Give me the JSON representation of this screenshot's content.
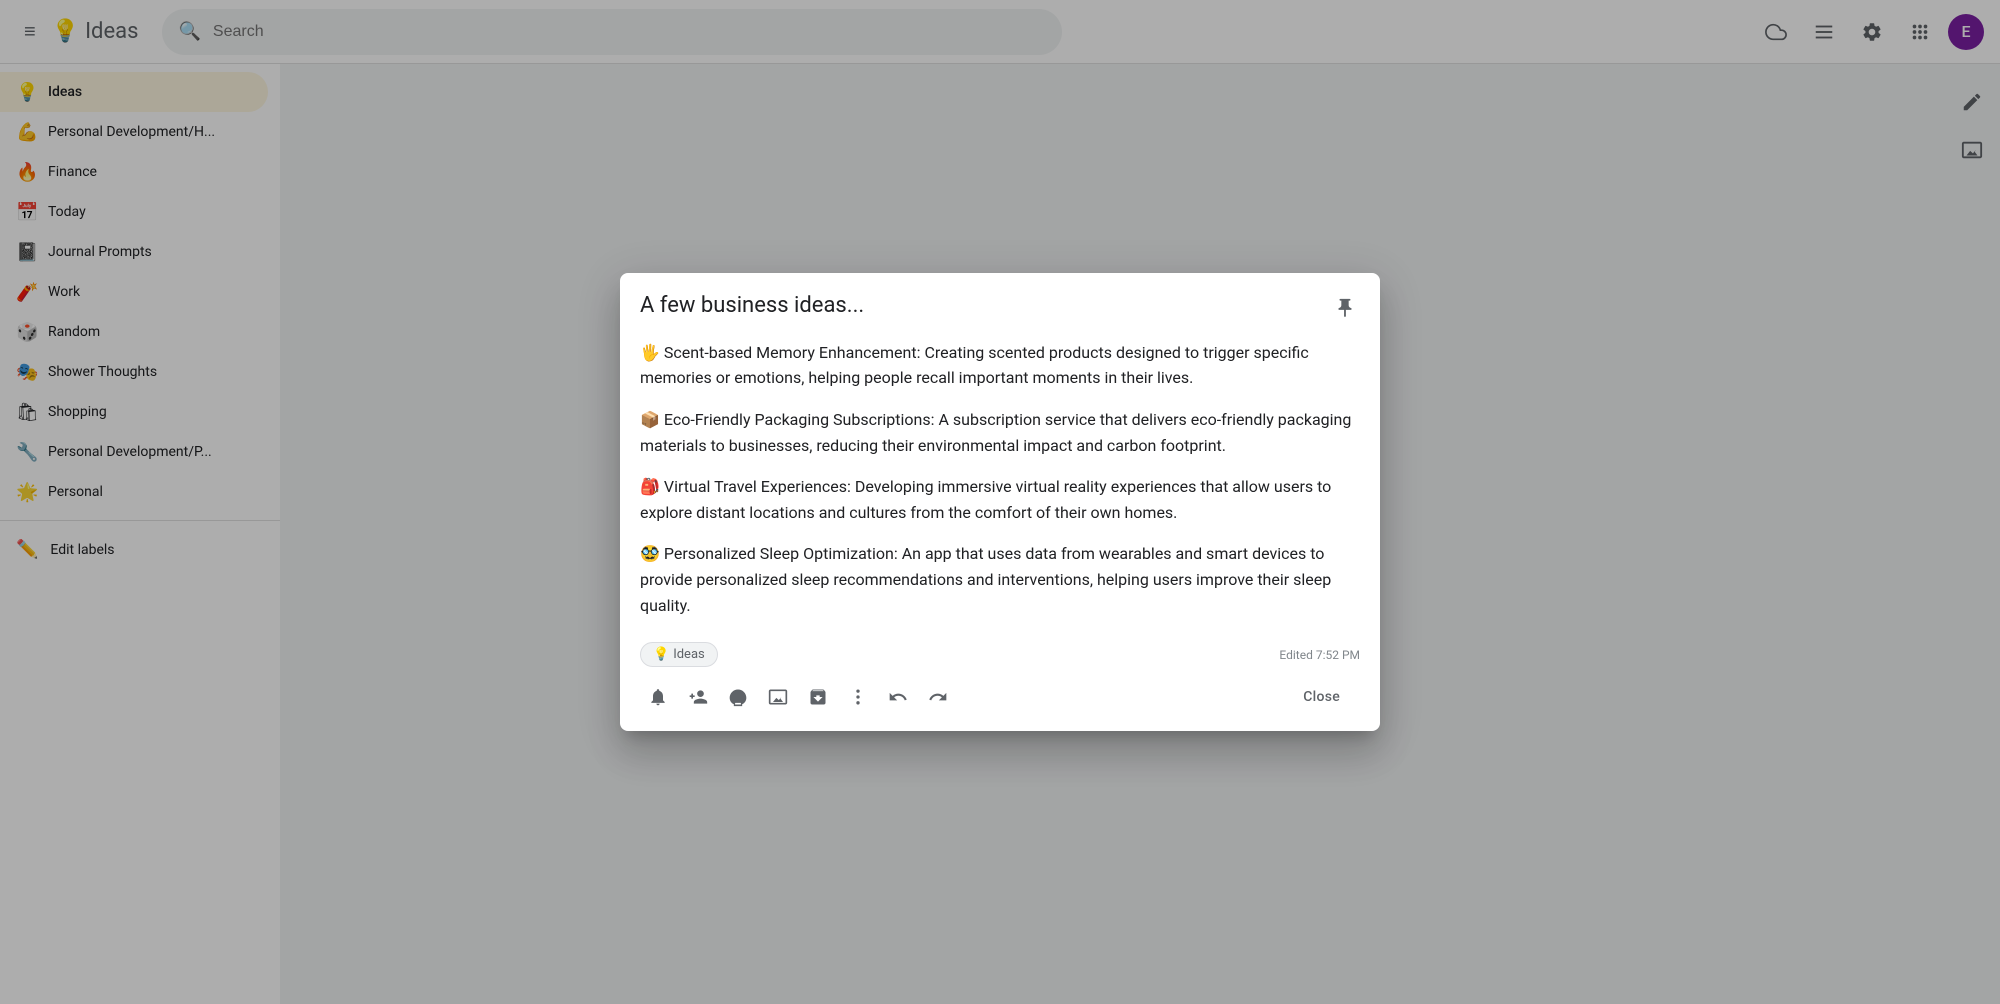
{
  "header": {
    "menu_label": "Main menu",
    "app_icon": "💡",
    "app_title": "Ideas",
    "search_placeholder": "Search",
    "cloud_icon": "☁",
    "grid_icon": "⊞",
    "settings_icon": "⚙",
    "apps_icon": "⋮⋮⋮",
    "avatar_letter": "E"
  },
  "sidebar": {
    "items": [
      {
        "id": "ideas",
        "icon": "💡",
        "label": "Ideas",
        "active": true
      },
      {
        "id": "personal-dev-h",
        "icon": "💪",
        "label": "Personal Development/H..."
      },
      {
        "id": "finance",
        "icon": "🔥",
        "label": "Finance"
      },
      {
        "id": "today",
        "icon": "📅",
        "label": "Today"
      },
      {
        "id": "journal-prompts",
        "icon": "📓",
        "label": "Journal Prompts"
      },
      {
        "id": "work",
        "icon": "🧨",
        "label": "Work"
      },
      {
        "id": "random",
        "icon": "🎲",
        "label": "Random"
      },
      {
        "id": "shower-thoughts",
        "icon": "🎭",
        "label": "Shower Thoughts"
      },
      {
        "id": "shopping",
        "icon": "🛍",
        "label": "Shopping"
      },
      {
        "id": "personal-dev-p",
        "icon": "🔧",
        "label": "Personal Development/P..."
      },
      {
        "id": "personal",
        "icon": "🌟",
        "label": "Personal"
      }
    ],
    "edit_labels": "Edit labels"
  },
  "right_toolbar": {
    "edit_icon": "✏",
    "image_icon": "🖼"
  },
  "modal": {
    "title": "A few business ideas...",
    "pin_icon": "📌",
    "body": [
      "🖐 Scent-based Memory Enhancement: Creating scented products designed to trigger specific memories or emotions, helping people recall important moments in their lives.",
      "📦 Eco-Friendly Packaging Subscriptions: A subscription service that delivers eco-friendly packaging materials to businesses, reducing their environmental impact and carbon footprint.",
      "🎒 Virtual Travel Experiences: Developing immersive virtual reality experiences that allow users to explore distant locations and cultures from the comfort of their own homes.",
      "🥸 Personalized Sleep Optimization: An app that uses data from wearables and smart devices to provide personalized sleep recommendations and interventions, helping users improve their sleep quality."
    ],
    "tag_icon": "💡",
    "tag_label": "Ideas",
    "edited_label": "Edited 7:52 PM",
    "actions": {
      "reminder": "🔔",
      "collaborator": "👤+",
      "color": "🎨",
      "image": "🖼",
      "archive": "📥",
      "more": "⋮",
      "undo": "↩",
      "redo": "↪"
    },
    "close_label": "Close"
  }
}
